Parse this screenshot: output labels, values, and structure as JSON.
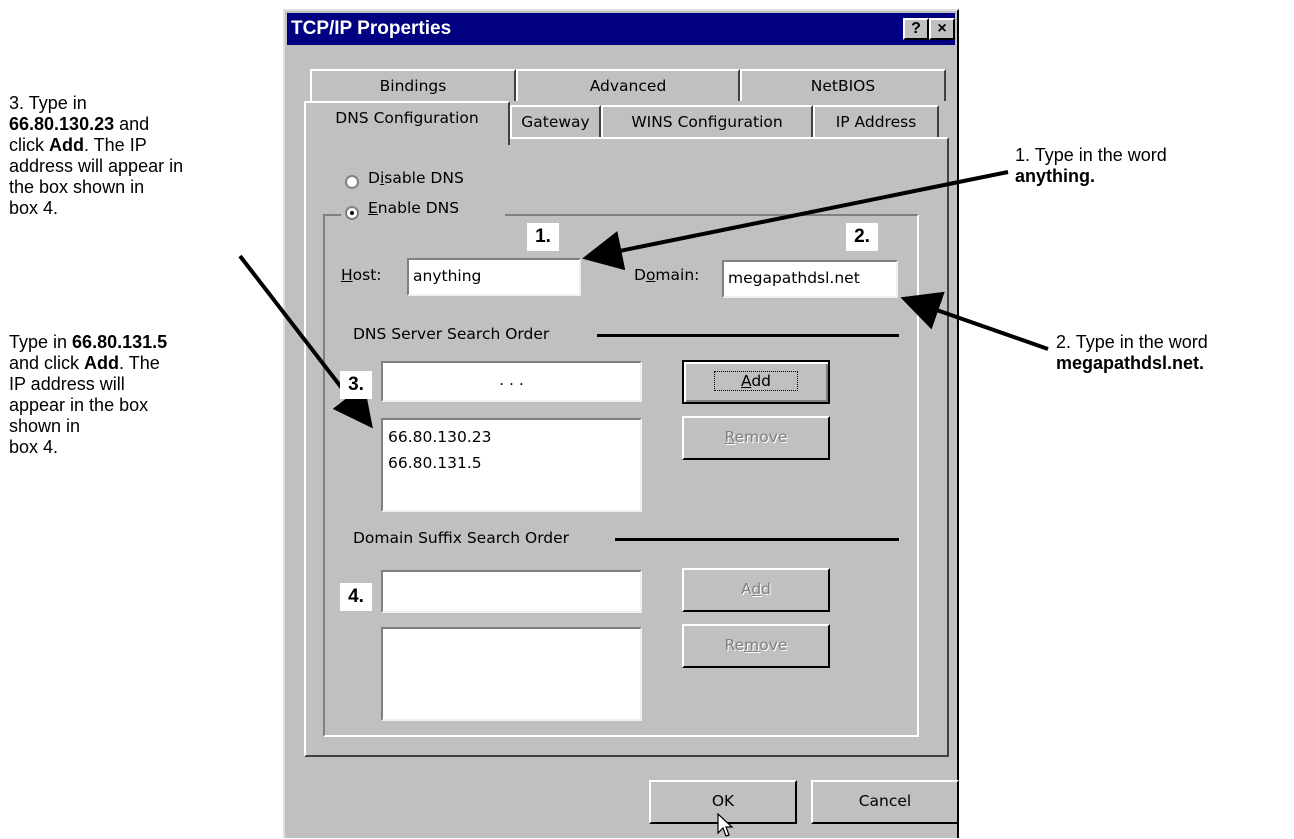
{
  "dialog": {
    "title": "TCP/IP Properties",
    "help_button": "?",
    "close_button": "×",
    "tabs_back": [
      "Bindings",
      "Advanced",
      "NetBIOS"
    ],
    "tabs_front": [
      "DNS Configuration",
      "Gateway",
      "WINS Configuration",
      "IP Address"
    ],
    "active_tab": "DNS Configuration",
    "disable_dns_pre": "D",
    "disable_dns_u": "i",
    "disable_dns_post": "sable DNS",
    "enable_dns_u": "E",
    "enable_dns_post": "nable DNS",
    "host_label_u": "H",
    "host_label_post": "ost:",
    "host_value": "anything",
    "domain_label_pre": "D",
    "domain_label_u": "o",
    "domain_label_post": "main:",
    "domain_value": "megapathdsl.net",
    "dns_server_group": "DNS Server Search Order",
    "ip_dots": ".          .          .",
    "add_u": "A",
    "add_post": "dd",
    "remove_u": "R",
    "remove_post": "emove",
    "dns_servers": [
      "66.80.130.23",
      "66.80.131.5"
    ],
    "domain_suffix_group": "Domain Suffix Search Order",
    "add2_pre": "A",
    "add2_u": "d",
    "add2_post": "d",
    "remove2_pre": "Re",
    "remove2_u": "m",
    "remove2_post": "ove",
    "ok": "OK",
    "cancel": "Cancel"
  },
  "badges": {
    "b1": "1.",
    "b2": "2.",
    "b3": "3.",
    "b4": "4."
  },
  "annotations": {
    "right1_line1": "1. Type in the word",
    "right1_bold": "anything.",
    "right2_line1": "2. Type in the word",
    "right2_bold": "megapathdsl.net.",
    "left3_l1": "3. Type in",
    "left3_b1": "66.80.130.23",
    "left3_t1": " and",
    "left3_l3a": "click ",
    "left3_add": "Add",
    "left3_l3b": ".  The IP",
    "left3_l4": "address will appear in",
    "left3_l5": "the box shown in",
    "left3_l6": "box 4.",
    "left4_a": "Type in ",
    "left4_b": "66.80.131.5",
    "left4_c": "and click ",
    "left4_add": "Add",
    "left4_d": ".  The",
    "left4_l3": "IP address will",
    "left4_l4": "appear in the box",
    "left4_l5": "shown in",
    "left4_l6": "box 4."
  }
}
